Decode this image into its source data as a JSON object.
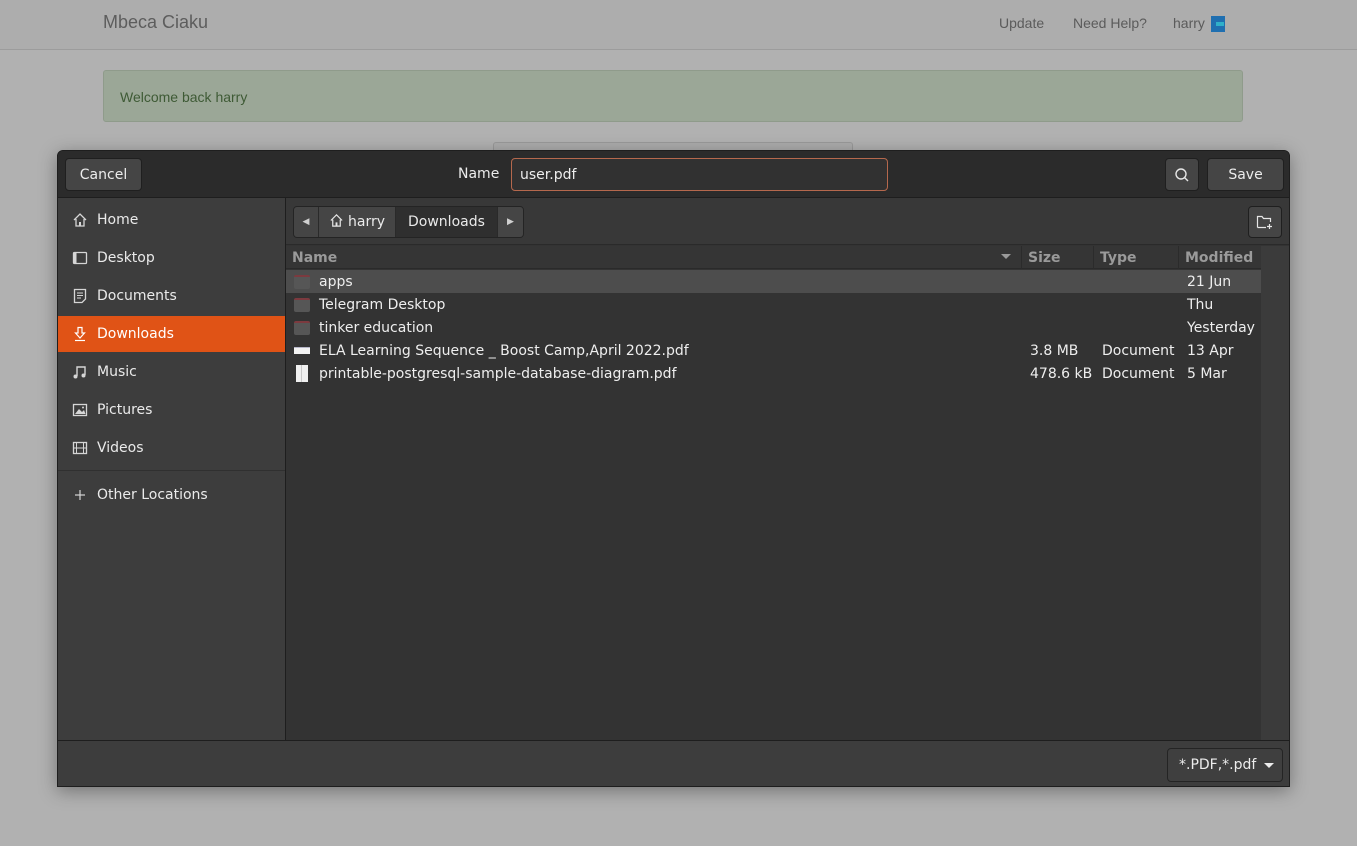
{
  "page": {
    "brand": "Mbeca Ciaku",
    "nav": {
      "update": "Update",
      "help": "Need Help?",
      "user": "harry"
    },
    "alert": "Welcome back harry"
  },
  "dialog": {
    "cancel_label": "Cancel",
    "save_label": "Save",
    "name_label": "Name",
    "name_value": "user.pdf",
    "sidebar": {
      "items": [
        {
          "label": "Home",
          "icon": "home-icon"
        },
        {
          "label": "Desktop",
          "icon": "desktop-icon"
        },
        {
          "label": "Documents",
          "icon": "documents-icon"
        },
        {
          "label": "Downloads",
          "icon": "downloads-icon",
          "active": true
        },
        {
          "label": "Music",
          "icon": "music-icon"
        },
        {
          "label": "Pictures",
          "icon": "pictures-icon"
        },
        {
          "label": "Videos",
          "icon": "videos-icon"
        }
      ],
      "other_locations": "Other Locations"
    },
    "path": [
      "harry",
      "Downloads"
    ],
    "columns": {
      "name": "Name",
      "size": "Size",
      "type": "Type",
      "modified": "Modified"
    },
    "files": [
      {
        "name": "apps",
        "size": "",
        "type": "",
        "modified": "21 Jun",
        "kind": "folder",
        "selected": true
      },
      {
        "name": "Telegram Desktop",
        "size": "",
        "type": "",
        "modified": "Thu",
        "kind": "folder"
      },
      {
        "name": "tinker education",
        "size": "",
        "type": "",
        "modified": "Yesterday",
        "kind": "folder"
      },
      {
        "name": "ELA Learning Sequence _ Boost Camp,April 2022.pdf",
        "size": "3.8 MB",
        "type": "Document",
        "modified": "13 Apr",
        "kind": "pdf"
      },
      {
        "name": "printable-postgresql-sample-database-diagram.pdf",
        "size": "478.6 kB",
        "type": "Document",
        "modified": "5 Mar",
        "kind": "pdf"
      }
    ],
    "filter": "*.PDF,*.pdf",
    "accent_color": "#e05316"
  }
}
